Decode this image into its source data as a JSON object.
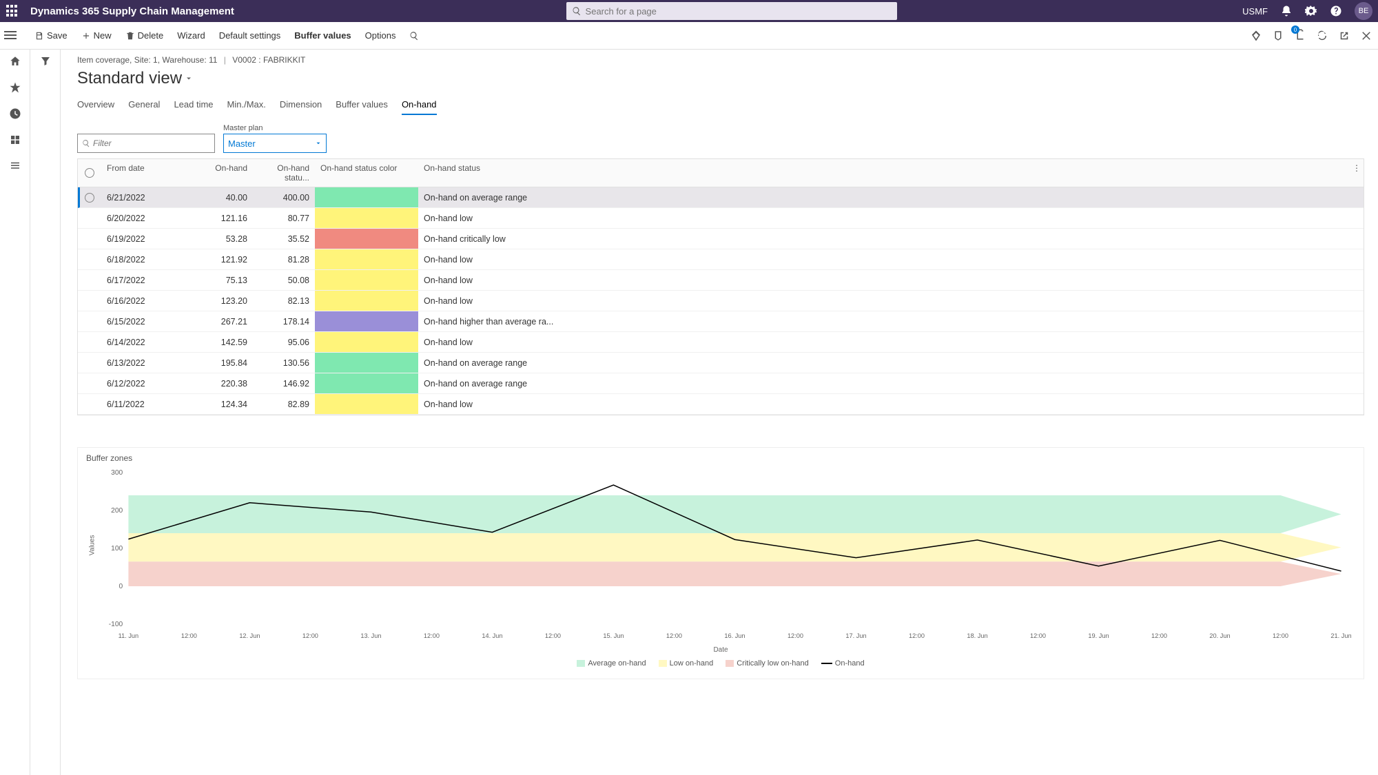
{
  "topbar": {
    "app_title": "Dynamics 365 Supply Chain Management",
    "search_placeholder": "Search for a page",
    "company": "USMF",
    "avatar": "BE"
  },
  "actionbar": {
    "save": "Save",
    "new": "New",
    "delete": "Delete",
    "wizard": "Wizard",
    "default_settings": "Default settings",
    "buffer_values": "Buffer values",
    "options": "Options",
    "badge": "0"
  },
  "breadcrumb": {
    "part1": "Item coverage, Site: 1, Warehouse: 11",
    "part2": "V0002 : FABRIKKIT"
  },
  "view_title": "Standard view",
  "tabs": [
    {
      "label": "Overview",
      "active": false
    },
    {
      "label": "General",
      "active": false
    },
    {
      "label": "Lead time",
      "active": false
    },
    {
      "label": "Min./Max.",
      "active": false
    },
    {
      "label": "Dimension",
      "active": false
    },
    {
      "label": "Buffer values",
      "active": false
    },
    {
      "label": "On‑hand",
      "active": true
    }
  ],
  "filter_placeholder": "Filter",
  "master_plan": {
    "label": "Master plan",
    "value": "Master"
  },
  "columns": {
    "from_date": "From date",
    "on_hand": "On‑hand",
    "status_pct": "On‑hand statu...",
    "status_color": "On‑hand status color",
    "status": "On‑hand status"
  },
  "status_colors": {
    "green": "#7fe8b0",
    "yellow": "#fff47a",
    "red": "#f08a80",
    "purple": "#9a8fd8"
  },
  "rows": [
    {
      "date": "6/21/2022",
      "onhand": "40.00",
      "pct": "400.00",
      "color": "green",
      "status": "On-hand on average range",
      "selected": true
    },
    {
      "date": "6/20/2022",
      "onhand": "121.16",
      "pct": "80.77",
      "color": "yellow",
      "status": "On-hand low"
    },
    {
      "date": "6/19/2022",
      "onhand": "53.28",
      "pct": "35.52",
      "color": "red",
      "status": "On-hand critically low"
    },
    {
      "date": "6/18/2022",
      "onhand": "121.92",
      "pct": "81.28",
      "color": "yellow",
      "status": "On-hand low"
    },
    {
      "date": "6/17/2022",
      "onhand": "75.13",
      "pct": "50.08",
      "color": "yellow",
      "status": "On-hand low"
    },
    {
      "date": "6/16/2022",
      "onhand": "123.20",
      "pct": "82.13",
      "color": "yellow",
      "status": "On-hand low"
    },
    {
      "date": "6/15/2022",
      "onhand": "267.21",
      "pct": "178.14",
      "color": "purple",
      "status": "On-hand higher than average ra..."
    },
    {
      "date": "6/14/2022",
      "onhand": "142.59",
      "pct": "95.06",
      "color": "yellow",
      "status": "On-hand low"
    },
    {
      "date": "6/13/2022",
      "onhand": "195.84",
      "pct": "130.56",
      "color": "green",
      "status": "On-hand on average range"
    },
    {
      "date": "6/12/2022",
      "onhand": "220.38",
      "pct": "146.92",
      "color": "green",
      "status": "On-hand on average range"
    },
    {
      "date": "6/11/2022",
      "onhand": "124.34",
      "pct": "82.89",
      "color": "yellow",
      "status": "On-hand low"
    }
  ],
  "chart_title": "Buffer zones",
  "chart_data": {
    "type": "line",
    "title": "Buffer zones",
    "xlabel": "Date",
    "ylabel": "Values",
    "ylim": [
      -100,
      300
    ],
    "yticks": [
      -100,
      0,
      100,
      200,
      300
    ],
    "x_categories": [
      "11. Jun",
      "12:00",
      "12. Jun",
      "12:00",
      "13. Jun",
      "12:00",
      "14. Jun",
      "12:00",
      "15. Jun",
      "12:00",
      "16. Jun",
      "12:00",
      "17. Jun",
      "12:00",
      "18. Jun",
      "12:00",
      "19. Jun",
      "12:00",
      "20. Jun",
      "12:00",
      "21. Jun"
    ],
    "series_onhand": {
      "name": "On-hand",
      "x": [
        "6/11",
        "6/12",
        "6/13",
        "6/14",
        "6/15",
        "6/16",
        "6/17",
        "6/18",
        "6/19",
        "6/20",
        "6/21"
      ],
      "y": [
        124.34,
        220.38,
        195.84,
        142.59,
        267.21,
        123.2,
        75.13,
        121.92,
        53.28,
        121.16,
        40.0
      ]
    },
    "zones": {
      "average": {
        "name": "Average on-hand",
        "color": "#c7f2dc",
        "y0": 140,
        "y1": 240
      },
      "low": {
        "name": "Low on-hand",
        "color": "#fff8c2",
        "y0": 65,
        "y1": 140
      },
      "crit": {
        "name": "Critically low on-hand",
        "color": "#f6d2cc",
        "y0": 0,
        "y1": 65
      }
    },
    "legend": [
      "Average on-hand",
      "Low on-hand",
      "Critically low on-hand",
      "On-hand"
    ]
  }
}
